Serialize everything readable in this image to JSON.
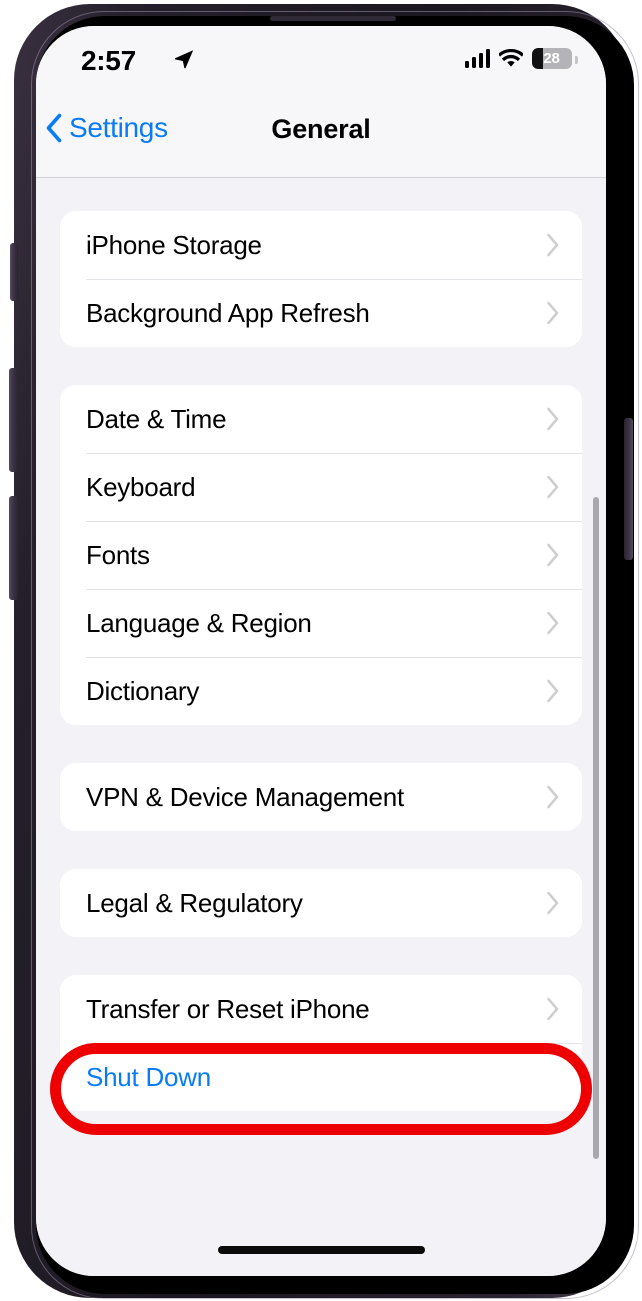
{
  "device": {
    "name": "iPhone 14 Pro",
    "frame_color": "#2a2430",
    "screen_background": "#f2f2f7"
  },
  "status_bar": {
    "time": "2:57",
    "location_icon": "location-arrow-icon",
    "cellular_icon": "cellular-bars-icon",
    "cellular_bars": 4,
    "wifi_icon": "wifi-icon",
    "battery_icon": "battery-icon",
    "battery_percent": "28",
    "battery_fill_ratio": 0.28
  },
  "nav_bar": {
    "back_label": "Settings",
    "back_icon": "chevron-left-icon",
    "title": "General",
    "accent_color": "#0a7bf7"
  },
  "groups": [
    {
      "id": "storage-group",
      "rows": [
        {
          "label": "iPhone Storage",
          "accessory": "chevron-right-icon",
          "style": "default"
        },
        {
          "label": "Background App Refresh",
          "accessory": "chevron-right-icon",
          "style": "default"
        }
      ]
    },
    {
      "id": "locale-group",
      "rows": [
        {
          "label": "Date & Time",
          "accessory": "chevron-right-icon",
          "style": "default"
        },
        {
          "label": "Keyboard",
          "accessory": "chevron-right-icon",
          "style": "default"
        },
        {
          "label": "Fonts",
          "accessory": "chevron-right-icon",
          "style": "default"
        },
        {
          "label": "Language & Region",
          "accessory": "chevron-right-icon",
          "style": "default"
        },
        {
          "label": "Dictionary",
          "accessory": "chevron-right-icon",
          "style": "default"
        }
      ]
    },
    {
      "id": "vpn-group",
      "rows": [
        {
          "label": "VPN & Device Management",
          "accessory": "chevron-right-icon",
          "style": "default"
        }
      ]
    },
    {
      "id": "legal-group",
      "rows": [
        {
          "label": "Legal & Regulatory",
          "accessory": "chevron-right-icon",
          "style": "default"
        }
      ]
    },
    {
      "id": "reset-group",
      "rows": [
        {
          "label": "Transfer or Reset iPhone",
          "accessory": "chevron-right-icon",
          "style": "default"
        },
        {
          "label": "Shut Down",
          "accessory": "none",
          "style": "link"
        }
      ]
    }
  ],
  "annotation": {
    "type": "oval-highlight",
    "color": "#ee0000",
    "target_label": "Transfer or Reset iPhone"
  },
  "home_indicator": "home-indicator"
}
